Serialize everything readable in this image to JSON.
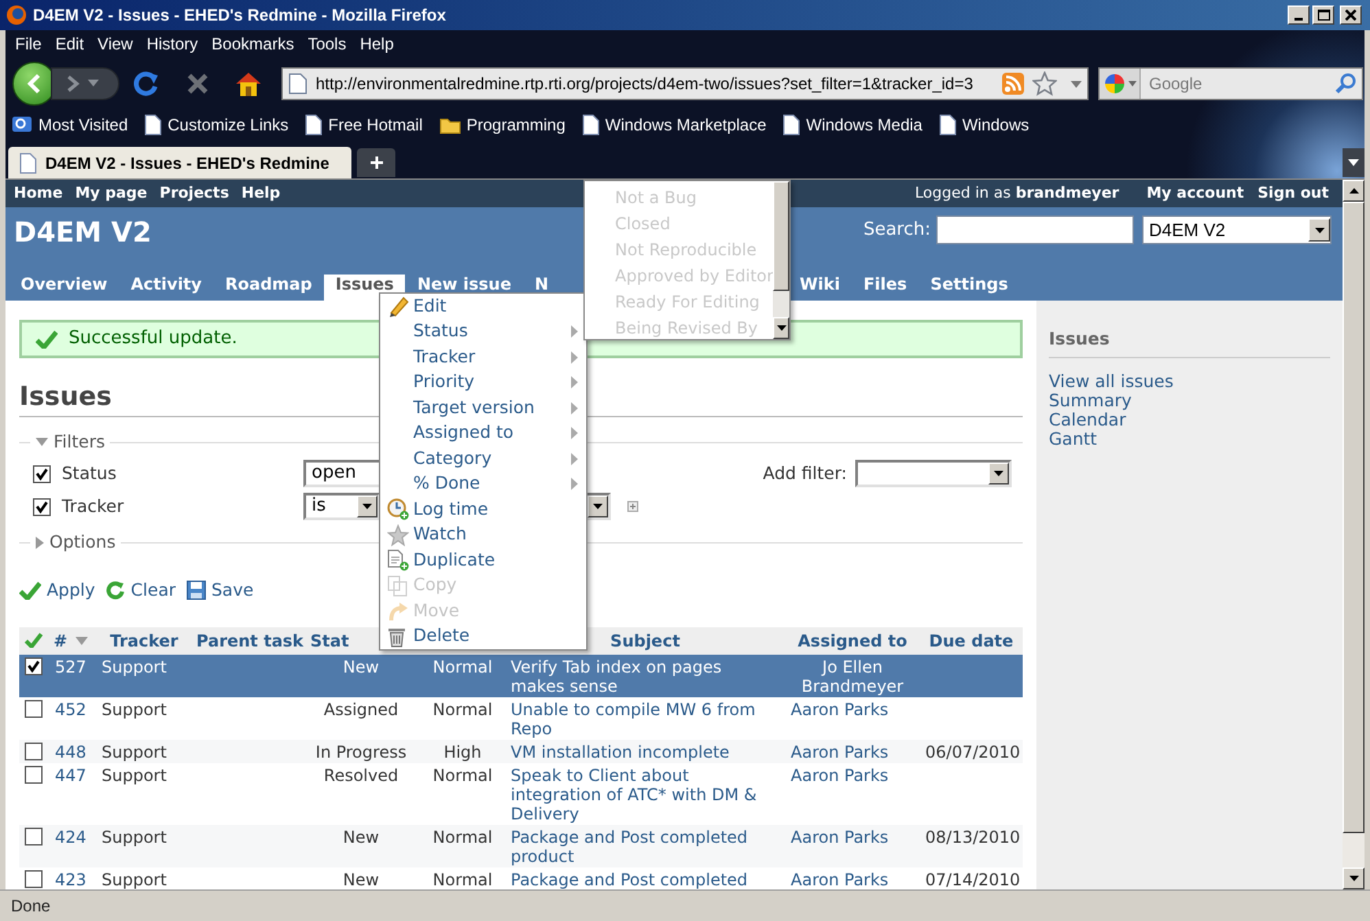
{
  "window": {
    "title": "D4EM V2 - Issues - EHED's Redmine - Mozilla Firefox"
  },
  "menu_bar": [
    "File",
    "Edit",
    "View",
    "History",
    "Bookmarks",
    "Tools",
    "Help"
  ],
  "address_bar": {
    "url": "http://environmentalredmine.rtp.rti.org/projects/d4em-two/issues?set_filter=1&tracker_id=3"
  },
  "search_box": {
    "placeholder": "Google"
  },
  "bookmarks": [
    {
      "label": "Most Visited",
      "kind": "smart"
    },
    {
      "label": "Customize Links",
      "kind": "page"
    },
    {
      "label": "Free Hotmail",
      "kind": "page"
    },
    {
      "label": "Programming",
      "kind": "folder"
    },
    {
      "label": "Windows Marketplace",
      "kind": "page"
    },
    {
      "label": "Windows Media",
      "kind": "page"
    },
    {
      "label": "Windows",
      "kind": "page"
    }
  ],
  "browser_tabs": [
    {
      "label": "D4EM V2 - Issues - EHED's Redmine",
      "selected": true
    }
  ],
  "top_menu": [
    "Home",
    "My page",
    "Projects",
    "Help"
  ],
  "logged_in": "Logged in as **brandmeyer**",
  "account_menu": [
    "My account",
    "Sign out"
  ],
  "project_title": "D4EM V2",
  "search": {
    "label": "Search:",
    "project": "D4EM V2"
  },
  "tabs": [
    {
      "label": "Overview",
      "selected": false
    },
    {
      "label": "Activity",
      "selected": false
    },
    {
      "label": "Roadmap",
      "selected": false
    },
    {
      "label": "Issues",
      "selected": true
    },
    {
      "label": "New issue",
      "selected": false
    },
    {
      "label": "N",
      "selected": false
    },
    {
      "label": "Wiki",
      "selected": false
    },
    {
      "label": "Files",
      "selected": false
    },
    {
      "label": "Settings",
      "selected": false
    }
  ],
  "flash": "Successful update.",
  "heading": "Issues",
  "filters": {
    "legend": "Filters",
    "expanded": true,
    "add_filter_label": "Add filter:",
    "rows": [
      {
        "label": "Status",
        "checked": true,
        "operator": "open"
      },
      {
        "label": "Tracker",
        "checked": true,
        "operator": "is"
      }
    ]
  },
  "options": {
    "legend": "Options",
    "expanded": false
  },
  "actions": [
    {
      "label": "Apply",
      "kind": "apply"
    },
    {
      "label": "Clear",
      "kind": "clear"
    },
    {
      "label": "Save",
      "kind": "save"
    }
  ],
  "table": {
    "columns": [
      "#",
      "Tracker",
      "Parent task",
      "Stat",
      "Subject",
      "Assigned to",
      "Due date"
    ],
    "rows": [
      {
        "selected": true,
        "checked": true,
        "id": "527",
        "tracker": "Support",
        "status": "New",
        "priority": "Normal",
        "subject": "Verify Tab index on pages makes sense",
        "assigned_to": "Jo Ellen Brandmeyer"
      },
      {
        "selected": false,
        "checked": false,
        "id": "452",
        "tracker": "Support",
        "status": "Assigned",
        "priority": "Normal",
        "subject": "Unable to compile MW 6 from Repo",
        "assigned_to": "Aaron Parks"
      },
      {
        "selected": false,
        "checked": false,
        "id": "448",
        "tracker": "Support",
        "status": "In Progress",
        "priority": "High",
        "subject": "VM installation incomplete",
        "assigned_to": "Aaron Parks",
        "due_date": "06/07/2010"
      },
      {
        "selected": false,
        "checked": false,
        "id": "447",
        "tracker": "Support",
        "status": "Resolved",
        "priority": "Normal",
        "subject": "Speak to Client about integration of ATC* with DM & Delivery",
        "assigned_to": "Aaron Parks"
      },
      {
        "selected": false,
        "checked": false,
        "id": "424",
        "tracker": "Support",
        "status": "New",
        "priority": "Normal",
        "subject": "Package and Post completed product",
        "assigned_to": "Aaron Parks",
        "due_date": "08/13/2010"
      },
      {
        "selected": false,
        "checked": false,
        "id": "423",
        "tracker": "Support",
        "status": "New",
        "priority": "Normal",
        "subject": "Package and Post completed",
        "assigned_to": "Aaron Parks",
        "due_date": "07/14/2010"
      }
    ]
  },
  "sidebar": {
    "title": "Issues",
    "links": [
      "View all issues",
      "Summary",
      "Calendar",
      "Gantt"
    ]
  },
  "context_menu": [
    {
      "label": "Edit",
      "kind": "edit",
      "disabled": false
    },
    {
      "label": "Status",
      "kind": "submenu",
      "disabled": false
    },
    {
      "label": "Tracker",
      "kind": "submenu",
      "disabled": false
    },
    {
      "label": "Priority",
      "kind": "submenu",
      "disabled": false
    },
    {
      "label": "Target version",
      "kind": "submenu",
      "disabled": false
    },
    {
      "label": "Assigned to",
      "kind": "submenu",
      "disabled": false
    },
    {
      "label": "Category",
      "kind": "submenu",
      "disabled": false
    },
    {
      "label": "% Done",
      "kind": "submenu",
      "disabled": false
    },
    {
      "label": "Log time",
      "kind": "log_time",
      "disabled": false
    },
    {
      "label": "Watch",
      "kind": "watch",
      "disabled": false
    },
    {
      "label": "Duplicate",
      "kind": "duplicate",
      "disabled": false
    },
    {
      "label": "Copy",
      "kind": "copy",
      "disabled": true
    },
    {
      "label": "Move",
      "kind": "move",
      "disabled": true
    },
    {
      "label": "Delete",
      "kind": "delete",
      "disabled": false
    }
  ],
  "status_dropdown": {
    "options": [
      {
        "label": "Not a Bug",
        "disabled": true
      },
      {
        "label": "Closed",
        "disabled": true
      },
      {
        "label": "Not Reproducible",
        "disabled": true
      },
      {
        "label": "Approved by Editor",
        "disabled": true
      },
      {
        "label": "Ready For Editing",
        "disabled": true
      },
      {
        "label": "Being Revised By",
        "disabled": true
      }
    ]
  },
  "status_bar": "Done"
}
